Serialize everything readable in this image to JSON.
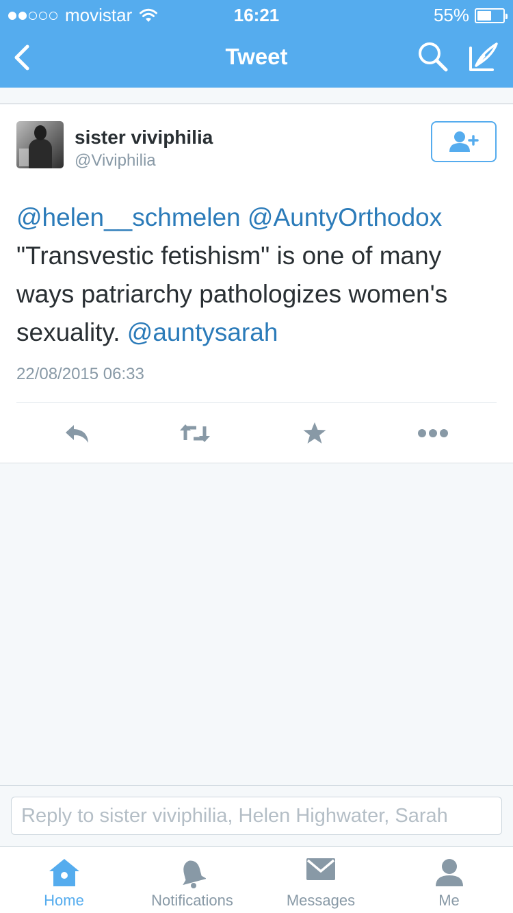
{
  "status_bar": {
    "carrier": "movistar",
    "time": "16:21",
    "battery": "55%",
    "battery_level": 0.55,
    "signal_bars_filled": 2,
    "signal_bars_total": 5
  },
  "nav": {
    "title": "Tweet",
    "icons": [
      "back-arrow-icon",
      "search-icon",
      "compose-icon"
    ]
  },
  "tweet": {
    "display_name": "sister viviphilia",
    "handle": "@Viviphilia",
    "mention_1": "@helen__schmelen",
    "mention_2": "@AuntyOrthodox",
    "body": "\"Transvestic fetishism\" is one of many ways patriarchy pathologizes women's sexuality.",
    "mention_3": "@auntysarah",
    "timestamp": "22/08/2015 06:33",
    "actions": [
      "reply-icon",
      "retweet-icon",
      "favorite-icon",
      "more-icon"
    ]
  },
  "reply": {
    "placeholder": "Reply to sister viviphilia, Helen Highwater, Sarah"
  },
  "tabs": [
    {
      "label": "Home",
      "icon": "home-icon",
      "active": true
    },
    {
      "label": "Notifications",
      "icon": "bell-icon",
      "active": false
    },
    {
      "label": "Messages",
      "icon": "envelope-icon",
      "active": false
    },
    {
      "label": "Me",
      "icon": "person-icon",
      "active": false
    }
  ],
  "colors": {
    "accent": "#55acee",
    "link": "#2b7bb9",
    "muted": "#8899a6",
    "text": "#292f33"
  }
}
